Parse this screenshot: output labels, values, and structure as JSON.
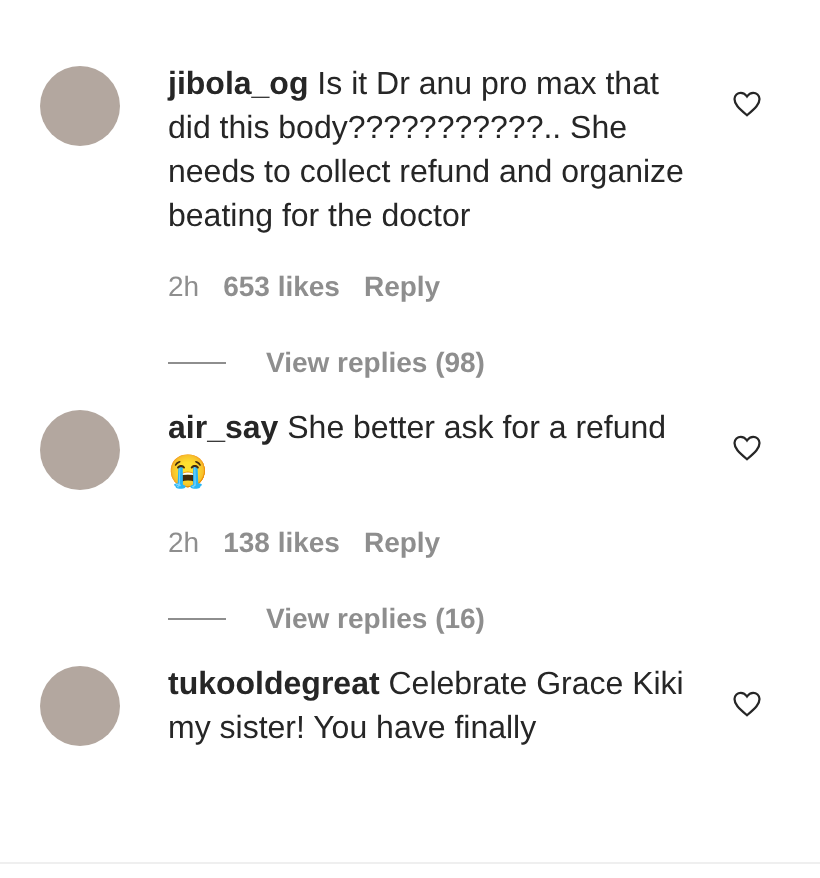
{
  "comments": [
    {
      "username": "jibola_og",
      "text": "Is it Dr anu pro max that did this body???????????.. She needs to collect refund and organize beating for the doctor",
      "liked": false,
      "time": "2h",
      "likes": "653 likes",
      "reply": "Reply",
      "view_replies": "View replies (98)"
    },
    {
      "username": "air_say",
      "text": "She better ask for a refund 😭",
      "liked": false,
      "time": "2h",
      "likes": "138 likes",
      "reply": "Reply",
      "view_replies": "View replies (16)"
    },
    {
      "username": "tukooldegreat",
      "text": "Celebrate Grace Kiki my sister! You have finally",
      "liked": false
    }
  ]
}
